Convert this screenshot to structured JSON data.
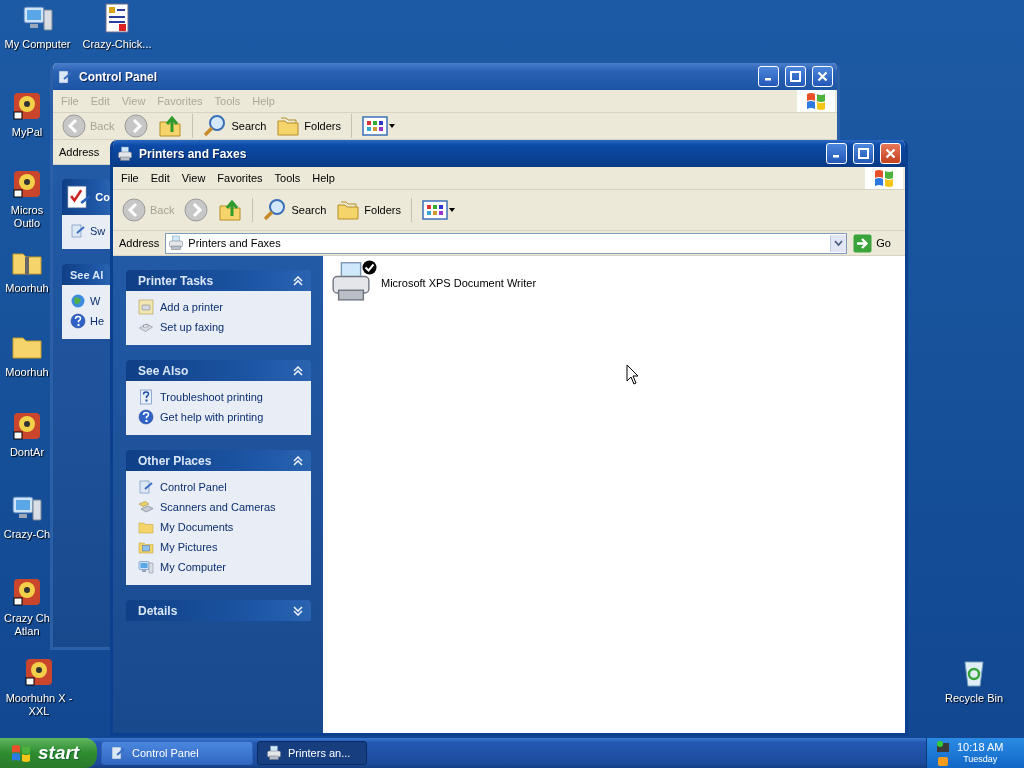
{
  "desktop_icons": [
    {
      "lines": [
        "My Computer"
      ],
      "kind": "computer"
    },
    {
      "lines": [
        "Crazy-Chick..."
      ],
      "kind": "document"
    },
    {
      "lines": [
        "MyPal"
      ],
      "kind": "app"
    },
    {
      "lines": [
        "Micros",
        "Outlo"
      ],
      "kind": "app"
    },
    {
      "lines": [
        "Moorhuh"
      ],
      "kind": "zip"
    },
    {
      "lines": [
        "Moorhuh"
      ],
      "kind": "folder"
    },
    {
      "lines": [
        "DontAr"
      ],
      "kind": "app"
    },
    {
      "lines": [
        "Crazy-Ch"
      ],
      "kind": "computer"
    },
    {
      "lines": [
        "Crazy Ch",
        "Atlan"
      ],
      "kind": "app"
    },
    {
      "lines": [
        "Moorhuhn X -",
        "XXL"
      ],
      "kind": "app"
    },
    {
      "lines": [
        "Recycle Bin"
      ],
      "kind": "recycle"
    }
  ],
  "control_panel_window": {
    "title": "Control Panel",
    "active": false,
    "menu": [
      "File",
      "Edit",
      "View",
      "Favorites",
      "Tools",
      "Help"
    ],
    "toolbar": {
      "back": {
        "label": "Back",
        "disabled": true
      },
      "forward": {
        "disabled": true
      },
      "search": "Search",
      "folders": "Folders"
    },
    "address_label": "Address",
    "task_pane": [
      {
        "title": "Co",
        "kind": "main",
        "items": [
          {
            "label": "Sw",
            "kind": "control-panel"
          }
        ]
      },
      {
        "title": "See Al",
        "kind": "normal",
        "items": [
          {
            "label": "W",
            "kind": "globe"
          },
          {
            "label": "He",
            "kind": "help"
          }
        ]
      }
    ]
  },
  "printers_window": {
    "title": "Printers and Faxes",
    "active": true,
    "menu": [
      "File",
      "Edit",
      "View",
      "Favorites",
      "Tools",
      "Help"
    ],
    "toolbar": {
      "back": {
        "label": "Back",
        "disabled": true
      },
      "forward": {
        "disabled": true
      },
      "search": "Search",
      "folders": "Folders"
    },
    "address_label": "Address",
    "address": "Printers and Faxes",
    "go": "Go",
    "task_pane": [
      {
        "title": "Printer Tasks",
        "kind": "normal",
        "expanded": true,
        "items": [
          {
            "label": "Add a printer",
            "kind": "add-printer"
          },
          {
            "label": "Set up faxing",
            "kind": "fax"
          }
        ]
      },
      {
        "title": "See Also",
        "kind": "normal",
        "expanded": true,
        "items": [
          {
            "label": "Troubleshoot printing",
            "kind": "help-doc"
          },
          {
            "label": "Get help with printing",
            "kind": "help"
          }
        ]
      },
      {
        "title": "Other Places",
        "kind": "normal",
        "expanded": true,
        "items": [
          {
            "label": "Control Panel",
            "kind": "control-panel"
          },
          {
            "label": "Scanners and Cameras",
            "kind": "scanner"
          },
          {
            "label": "My Documents",
            "kind": "documents"
          },
          {
            "label": "My Pictures",
            "kind": "pictures"
          },
          {
            "label": "My Computer",
            "kind": "computer"
          }
        ]
      },
      {
        "title": "Details",
        "kind": "normal",
        "expanded": false
      }
    ],
    "printers": [
      {
        "name": "Microsoft XPS Document Writer",
        "default": true
      }
    ]
  },
  "taskbar": {
    "start": "start",
    "tasks": [
      {
        "label": "Control Panel",
        "selected": false
      },
      {
        "label": "Printers an...",
        "selected": true
      }
    ],
    "time": "10:18 AM",
    "day": "Tuesday"
  }
}
